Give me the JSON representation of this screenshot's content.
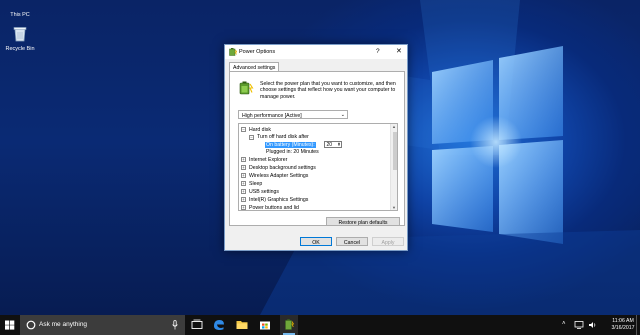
{
  "desktop": {
    "icons": [
      {
        "label": "This PC",
        "icon": "this-pc-icon"
      },
      {
        "label": "Recycle Bin",
        "icon": "recycle-bin-icon"
      }
    ]
  },
  "dialog": {
    "title": "Power Options",
    "help_glyph": "?",
    "close_glyph": "✕",
    "tab": "Advanced settings",
    "instructions": "Select the power plan that you want to customize, and then choose settings that reflect how you want your computer to manage power.",
    "plan_select": {
      "value": "High performance [Active]"
    },
    "tree": [
      {
        "text": "Hard disk",
        "expander": "−"
      },
      {
        "text": "Turn off hard disk after",
        "expander": "−"
      },
      {
        "text": "On battery (Minutes):",
        "value": "20"
      },
      {
        "text": "Plugged in: 20 Minutes"
      },
      {
        "text": "Internet Explorer",
        "expander": "+"
      },
      {
        "text": "Desktop background settings",
        "expander": "+"
      },
      {
        "text": "Wireless Adapter Settings",
        "expander": "+"
      },
      {
        "text": "Sleep",
        "expander": "+"
      },
      {
        "text": "USB settings",
        "expander": "+"
      },
      {
        "text": "Intel(R) Graphics Settings",
        "expander": "+"
      },
      {
        "text": "Power buttons and lid",
        "expander": "+"
      }
    ],
    "buttons": {
      "restore": "Restore plan defaults",
      "ok": "OK",
      "cancel": "Cancel",
      "apply": "Apply"
    }
  },
  "taskbar": {
    "search_text": "Ask me anything",
    "time": "11:06 AM",
    "date": "3/16/2017",
    "pinned": [
      "task-view-icon",
      "edge-icon",
      "file-explorer-icon",
      "store-icon",
      "power-options-icon"
    ]
  },
  "colors": {
    "accent": "#0078d7",
    "selection": "#3399ff",
    "taskbar": "#101010"
  }
}
